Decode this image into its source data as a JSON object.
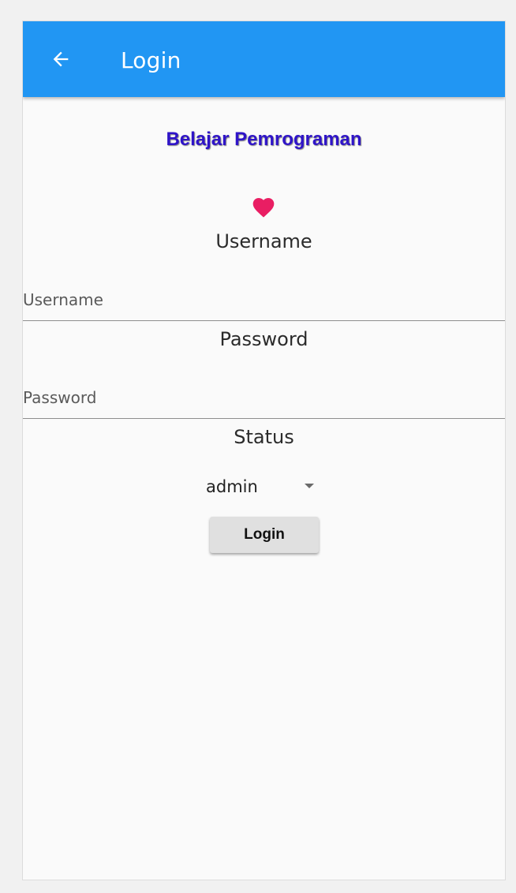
{
  "appbar": {
    "title": "Login",
    "back_icon": "arrow-back-icon",
    "color": "#2196f3"
  },
  "headline": {
    "text": "Belajar Pemrograman",
    "color": "#2f14c8"
  },
  "heart": {
    "icon": "heart-icon",
    "color": "#e91e63"
  },
  "form": {
    "username": {
      "label": "Username",
      "placeholder": "Username",
      "value": ""
    },
    "password": {
      "label": "Password",
      "placeholder": "Password",
      "value": ""
    },
    "status": {
      "label": "Status",
      "selected": "admin",
      "dropdown_icon": "arrow-drop-down-icon"
    },
    "submit_label": "Login"
  }
}
